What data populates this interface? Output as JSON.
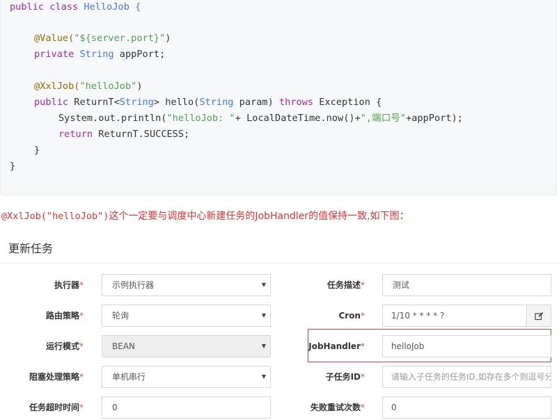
{
  "code": {
    "class_kw1": "public",
    "class_kw2": "class",
    "class_name": "HelloJob {",
    "value_anno": "@Value(",
    "value_str": "\"${server.port}\"",
    "value_close": ")",
    "priv_kw": "private",
    "priv_type": "String",
    "priv_rest": " appPort;",
    "xxl_anno": "@XxlJob(",
    "xxl_str": "\"helloJob\"",
    "xxl_close": ")",
    "m_public": "public",
    "m_ret1": " ReturnT<",
    "m_ret_type": "String",
    "m_ret2": "> hello(",
    "m_param_type": "String",
    "m_param_rest": " param) ",
    "m_throws": "throws",
    "m_exc": " Exception {",
    "print_pre": "System.out.println(",
    "print_s1": "\"helloJob: \"",
    "print_mid": "+ LocalDateTime.now()+",
    "print_s2": "\",端口号\"",
    "print_end": "+appPort);",
    "ret_kw": "return",
    "ret_rest": " ReturnT.SUCCESS;",
    "brace_inner": "}",
    "brace_outer": "}"
  },
  "note": {
    "code_part": "@XxlJob(\"helloJob\")",
    "text_part": "这个一定要与调度中心新建任务的JobHandler的值保持一致,如下图："
  },
  "form": {
    "title": "更新任务",
    "required_mark": "*",
    "fields": {
      "executor": {
        "label": "执行器",
        "value": "示例执行器"
      },
      "job_desc": {
        "label": "任务描述",
        "value": "测试"
      },
      "route": {
        "label": "路由策略",
        "value": "轮询"
      },
      "cron": {
        "label": "Cron",
        "value": "1/10 * * * * ?"
      },
      "run_mode": {
        "label": "运行模式",
        "value": "BEAN"
      },
      "job_handler": {
        "label": "JobHandler",
        "value": "helloJob"
      },
      "block": {
        "label": "阻塞处理策略",
        "value": "单机串行"
      },
      "child_job": {
        "label": "子任务ID",
        "placeholder": "请输入子任务的任务ID,如存在多个则逗号分隔"
      },
      "timeout": {
        "label": "任务超时时间",
        "value": "0"
      },
      "retry": {
        "label": "失败重试次数",
        "value": "0"
      }
    }
  },
  "colors": {
    "highlight_border": "#e03c3c",
    "note_text": "#e03131",
    "required": "#dd4b39"
  }
}
